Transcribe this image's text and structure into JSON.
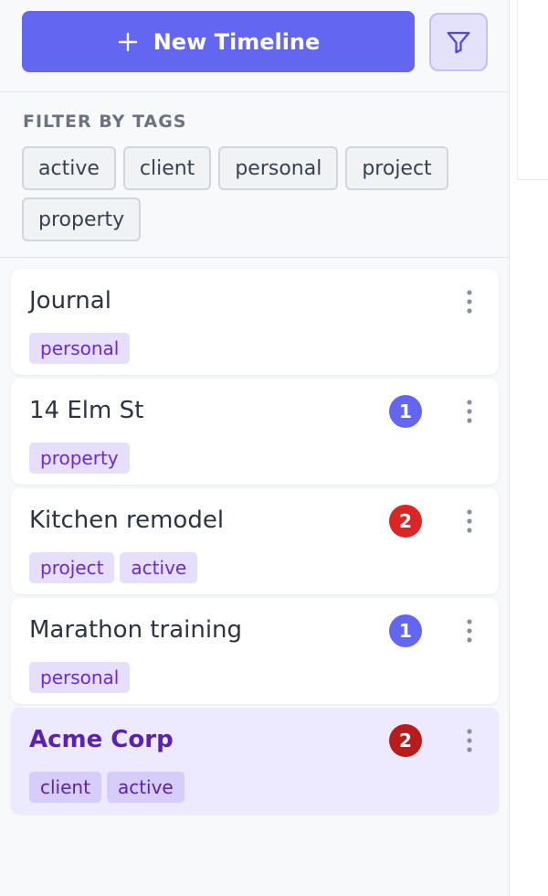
{
  "header": {
    "new_timeline_label": "New Timeline",
    "new_icon": "plus-icon",
    "filter_icon": "filter-icon"
  },
  "tags_filter": {
    "title": "FILTER BY TAGS",
    "tags": [
      "active",
      "client",
      "personal",
      "project",
      "property"
    ]
  },
  "timelines": [
    {
      "title": "Journal",
      "badge": null,
      "tags": [
        "personal"
      ],
      "selected": false
    },
    {
      "title": "14 Elm St",
      "badge": "1",
      "badge_color": "#6366f1",
      "tags": [
        "property"
      ],
      "selected": false
    },
    {
      "title": "Kitchen remodel",
      "badge": "2",
      "badge_color": "#dc2626",
      "tags": [
        "project",
        "active"
      ],
      "selected": false
    },
    {
      "title": "Marathon training",
      "badge": "1",
      "badge_color": "#6366f1",
      "tags": [
        "personal"
      ],
      "selected": false
    },
    {
      "title": "Acme Corp",
      "badge": "2",
      "badge_color": "#b91c1c",
      "tags": [
        "client",
        "active"
      ],
      "selected": true
    }
  ],
  "colors": {
    "accent": "#6366f1",
    "selected_bg": "#ede9fe",
    "tag_bg": "#e5dffc",
    "tag_text": "#6d28d9"
  }
}
